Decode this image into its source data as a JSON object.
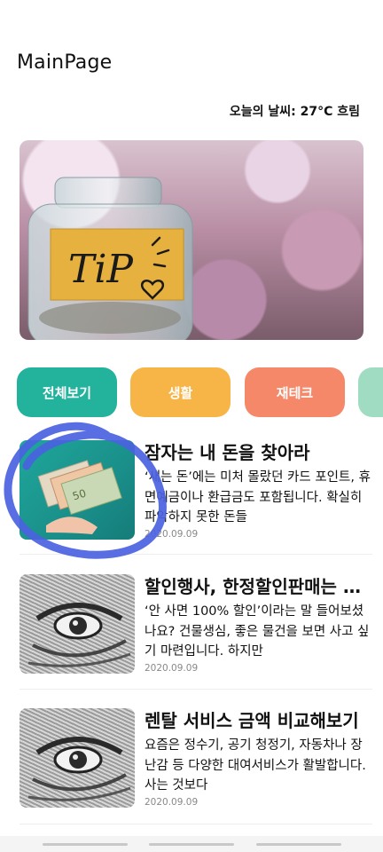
{
  "header": {
    "title": "MainPage",
    "weather": "오늘의 날씨: 27°C 흐림"
  },
  "hero": {
    "label": "TiP"
  },
  "categories": [
    {
      "label": "전체보기",
      "color": "#23b39c"
    },
    {
      "label": "생활",
      "color": "#f7b548"
    },
    {
      "label": "재테크",
      "color": "#f6886a"
    },
    {
      "label": "",
      "color": "#9fdcc2"
    }
  ],
  "articles": [
    {
      "title": "잠자는 내 돈을 찾아라",
      "body": "‘새는 돈’에는 미처 몰랐던 카드 포인트, 휴면예금이나 환급금도 포함됩니다. 확실히 파악하지 못한 돈들",
      "date": "2020.09.09",
      "thumb_icon": "money-icon"
    },
    {
      "title": "할인행사, 한정할인판매는 정말 이득일까",
      "body": "‘안 사면 100% 할인’이라는 말 들어보셨나요? 건물생심, 좋은 물건을 보면 사고 싶기 마련입니다. 하지만",
      "date": "2020.09.09",
      "thumb_icon": "banknote-eye-icon"
    },
    {
      "title": "렌탈 서비스 금액 비교해보기",
      "body": "요즘은 정수기, 공기 청정기, 자동차나 장난감 등 다양한 대여서비스가 활발합니다. 사는 것보다",
      "date": "2020.09.09",
      "thumb_icon": "banknote-eye-icon"
    }
  ],
  "annotation_color": "#4a62e0"
}
